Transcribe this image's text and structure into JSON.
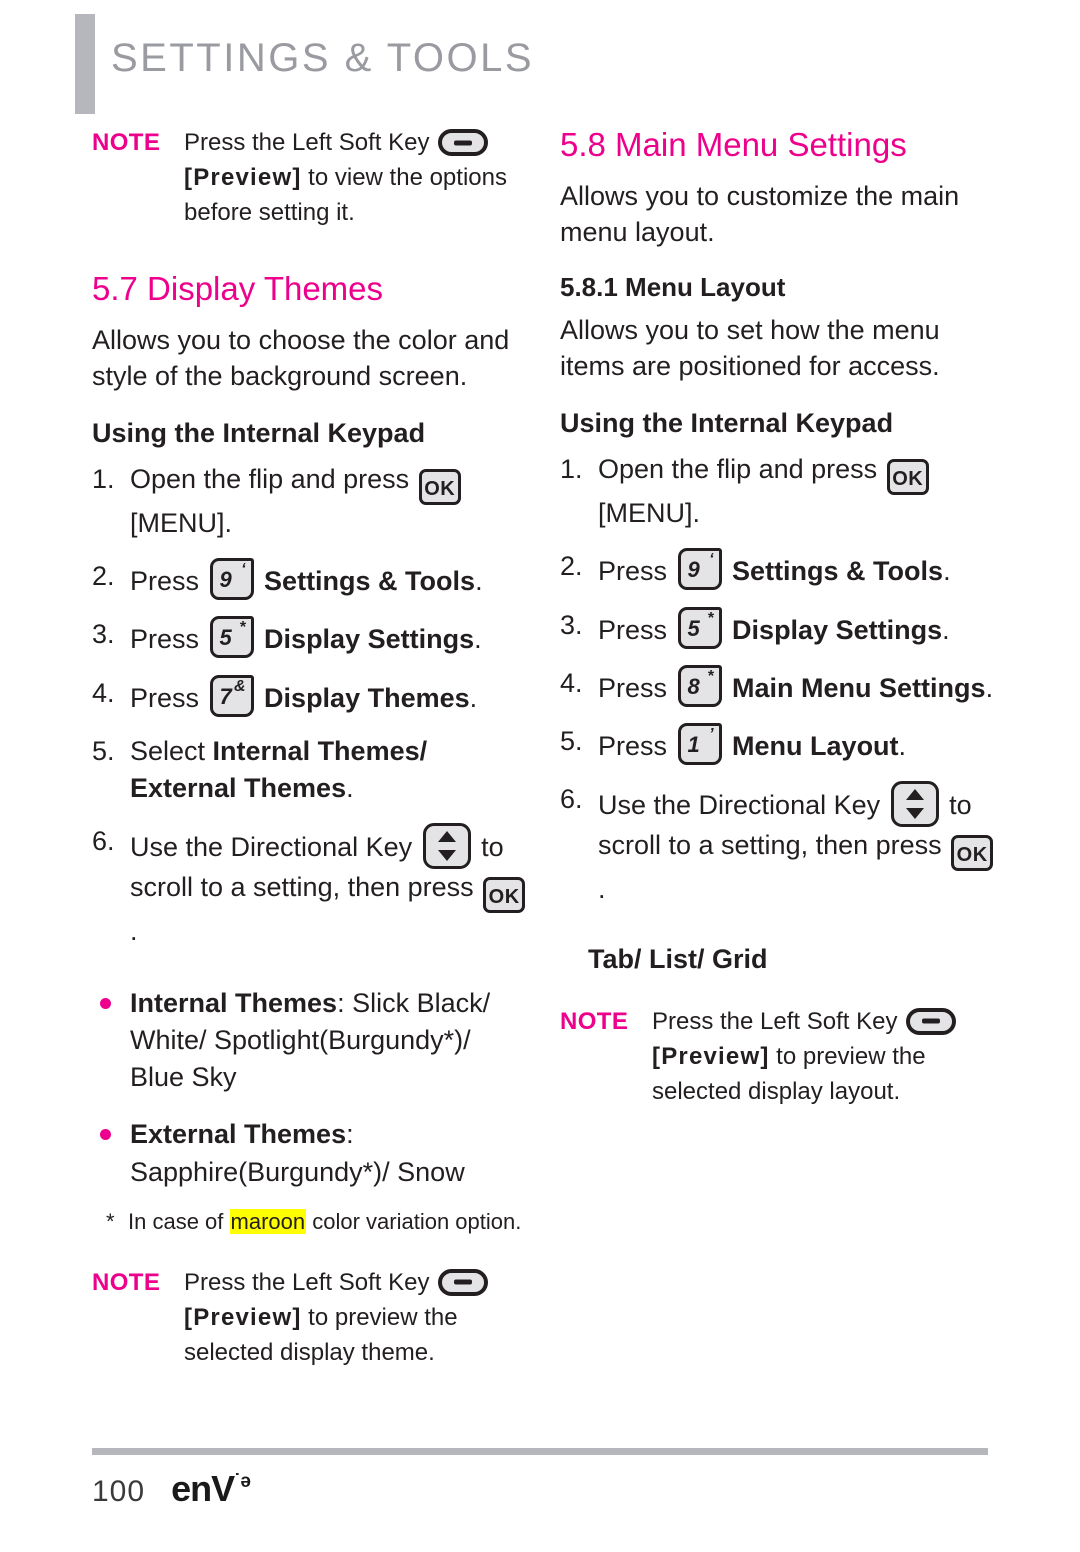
{
  "header": {
    "title": "SETTINGS & TOOLS",
    "accent_color": "#ec008c",
    "bar_color": "#b6b7bc"
  },
  "left_column": {
    "note_top": {
      "label": "NOTE",
      "line1_pre": "Press the Left Soft Key",
      "softkey_icon": "left-soft-key-icon",
      "line2_bold": "[Preview]",
      "line2_rest": " to view the options",
      "line3": "before setting it."
    },
    "section": {
      "number_title": "5.7 Display Themes",
      "intro": "Allows you to choose the color and style of the background screen.",
      "subheading": "Using the Internal Keypad"
    },
    "steps": [
      {
        "num": "1.",
        "pre": "Open the flip and press ",
        "key": {
          "type": "ok",
          "label": "OK"
        },
        "post": "",
        "second_line": "[MENU]."
      },
      {
        "num": "2.",
        "pre": "Press ",
        "key": {
          "type": "num",
          "main": "9",
          "sup": "‘"
        },
        "post_bold": "Settings & Tools",
        "post": "."
      },
      {
        "num": "3.",
        "pre": "Press ",
        "key": {
          "type": "num",
          "main": "5",
          "sup": "*"
        },
        "post_bold": "Display Settings",
        "post": "."
      },
      {
        "num": "4.",
        "pre": "Press ",
        "key": {
          "type": "num",
          "main": "7",
          "sup": "&"
        },
        "post_bold": "Display Themes",
        "post": "."
      },
      {
        "num": "5.",
        "pre": "Select ",
        "post_bold": "Internal Themes/ External Themes",
        "post": "."
      },
      {
        "num": "6.",
        "pre": "Use the Directional Key ",
        "key": {
          "type": "dir"
        },
        "mid": " to scroll to a setting, then press ",
        "key2": {
          "type": "ok",
          "label": "OK"
        },
        "post": "."
      }
    ],
    "bullets": [
      {
        "bold": "Internal Themes",
        "rest": ": Slick Black/ White/ Spotlight(Burgundy*)/ Blue Sky"
      },
      {
        "bold": "External Themes",
        "rest": ":",
        "second_line": "Sapphire(Burgundy*)/ Snow"
      }
    ],
    "footnote": {
      "mark": "*",
      "pre": "In case of ",
      "highlight": "maroon",
      "post": " color variation option."
    },
    "note_bottom": {
      "label": "NOTE",
      "line1_pre": "Press the Left Soft Key",
      "softkey_icon": "left-soft-key-icon",
      "line2_bold": "[Preview]",
      "line2_rest": " to preview the",
      "line3": "selected display theme."
    }
  },
  "right_column": {
    "section": {
      "number_title": "5.8 Main Menu Settings",
      "intro": "Allows you to customize the main menu layout.",
      "sub_number_title": "5.8.1 Menu Layout",
      "sub_intro": "Allows you to set how the menu items are positioned for access.",
      "subheading": "Using the Internal Keypad"
    },
    "steps": [
      {
        "num": "1.",
        "pre": "Open the flip and press ",
        "key": {
          "type": "ok",
          "label": "OK"
        },
        "second_line": "[MENU]."
      },
      {
        "num": "2.",
        "pre": "Press ",
        "key": {
          "type": "num",
          "main": "9",
          "sup": "‘"
        },
        "post_bold": "Settings & Tools",
        "post": "."
      },
      {
        "num": "3.",
        "pre": "Press ",
        "key": {
          "type": "num",
          "main": "5",
          "sup": "*"
        },
        "post_bold": "Display Settings",
        "post": "."
      },
      {
        "num": "4.",
        "pre": "Press ",
        "key": {
          "type": "num",
          "main": "8",
          "sup": "*"
        },
        "post_bold": "Main Menu Settings",
        "post": "."
      },
      {
        "num": "5.",
        "pre": "Press ",
        "key": {
          "type": "num",
          "main": "1",
          "sup": "’"
        },
        "post_bold": "Menu Layout",
        "post": "."
      },
      {
        "num": "6.",
        "pre": "Use the Directional Key ",
        "key": {
          "type": "dir"
        },
        "mid": " to scroll to a setting, then press ",
        "key2": {
          "type": "ok",
          "label": "OK"
        },
        "post": "."
      }
    ],
    "options_heading": "Tab/ List/ Grid",
    "note_bottom": {
      "label": "NOTE",
      "line1_pre": "Press the Left Soft Key",
      "softkey_icon": "left-soft-key-icon",
      "line2_bold": "[Preview]",
      "line2_rest": " to preview the",
      "line3": "selected display layout."
    }
  },
  "footer": {
    "page_number": "100",
    "logo_main": "enV",
    "logo_sup": "˙ǝ"
  }
}
